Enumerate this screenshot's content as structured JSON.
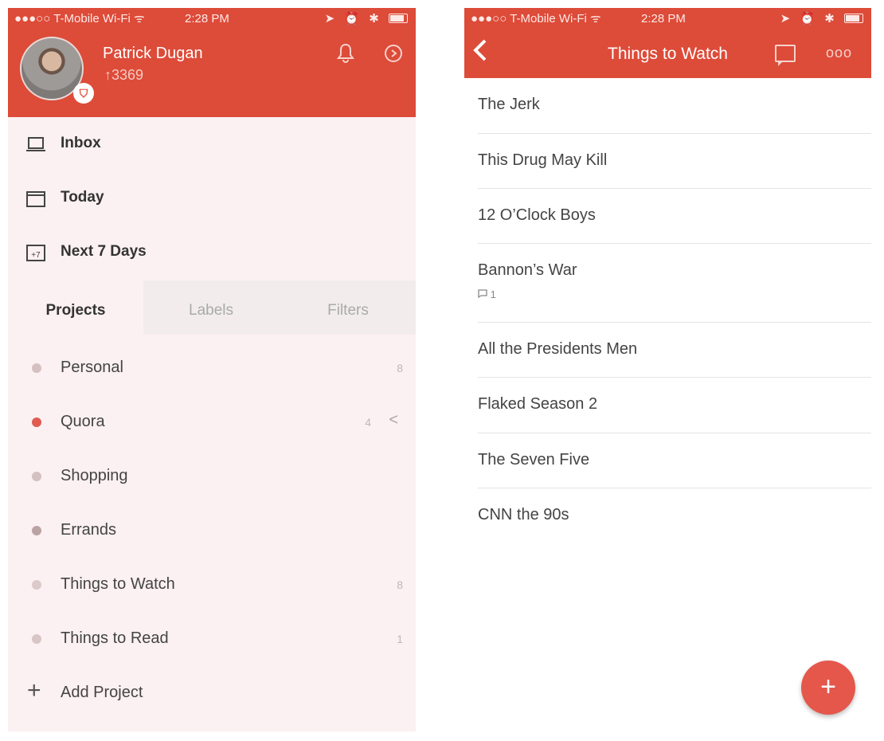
{
  "left": {
    "status": {
      "carrier": "●●●○○ T-Mobile Wi-Fi ᯤ",
      "time": "2:28 PM",
      "indicators": "➤ ⏰ ✱"
    },
    "profile": {
      "name": "Patrick Dugan",
      "karma": "↑3369",
      "badge": "⛉"
    },
    "nav": [
      {
        "label": "Inbox",
        "icon": "inbox-icon"
      },
      {
        "label": "Today",
        "icon": "calendar-icon"
      },
      {
        "label": "Next 7 Days",
        "icon": "next-7-days-icon",
        "badge": "+7"
      }
    ],
    "tabs": [
      "Projects",
      "Labels",
      "Filters"
    ],
    "projects": [
      {
        "name": "Personal",
        "count": "8",
        "color": "#d4c0c0"
      },
      {
        "name": "Quora",
        "count": "4",
        "color": "#e05b52"
      },
      {
        "name": "Shopping",
        "count": "",
        "color": "#d4c0c0"
      },
      {
        "name": "Errands",
        "count": "",
        "color": "#bba3a3"
      },
      {
        "name": "Things to Watch",
        "count": "8",
        "color": "#dcc9c9"
      },
      {
        "name": "Things to Read",
        "count": "1",
        "color": "#d8c5c5"
      }
    ],
    "add_project": "Add Project",
    "chevron": "<"
  },
  "right": {
    "status": {
      "carrier": "●●●○○ T-Mobile Wi-Fi ᯤ",
      "time": "2:28 PM",
      "indicators": "➤ ⏰ ✱"
    },
    "title": "Things to Watch",
    "back": "‹",
    "more": "ooo",
    "tasks": [
      {
        "title": "The Jerk"
      },
      {
        "title": "This Drug May Kill"
      },
      {
        "title": "12 O’Clock Boys"
      },
      {
        "title": "Bannon’s War",
        "comments": "1"
      },
      {
        "title": "All the Presidents Men"
      },
      {
        "title": "Flaked Season 2"
      },
      {
        "title": "The Seven Five"
      },
      {
        "title": "CNN the 90s"
      }
    ],
    "fab": "+"
  },
  "colors": {
    "accent": "#dd4b39",
    "panel_bg": "#fbf0f2",
    "fab": "#e5574b"
  }
}
